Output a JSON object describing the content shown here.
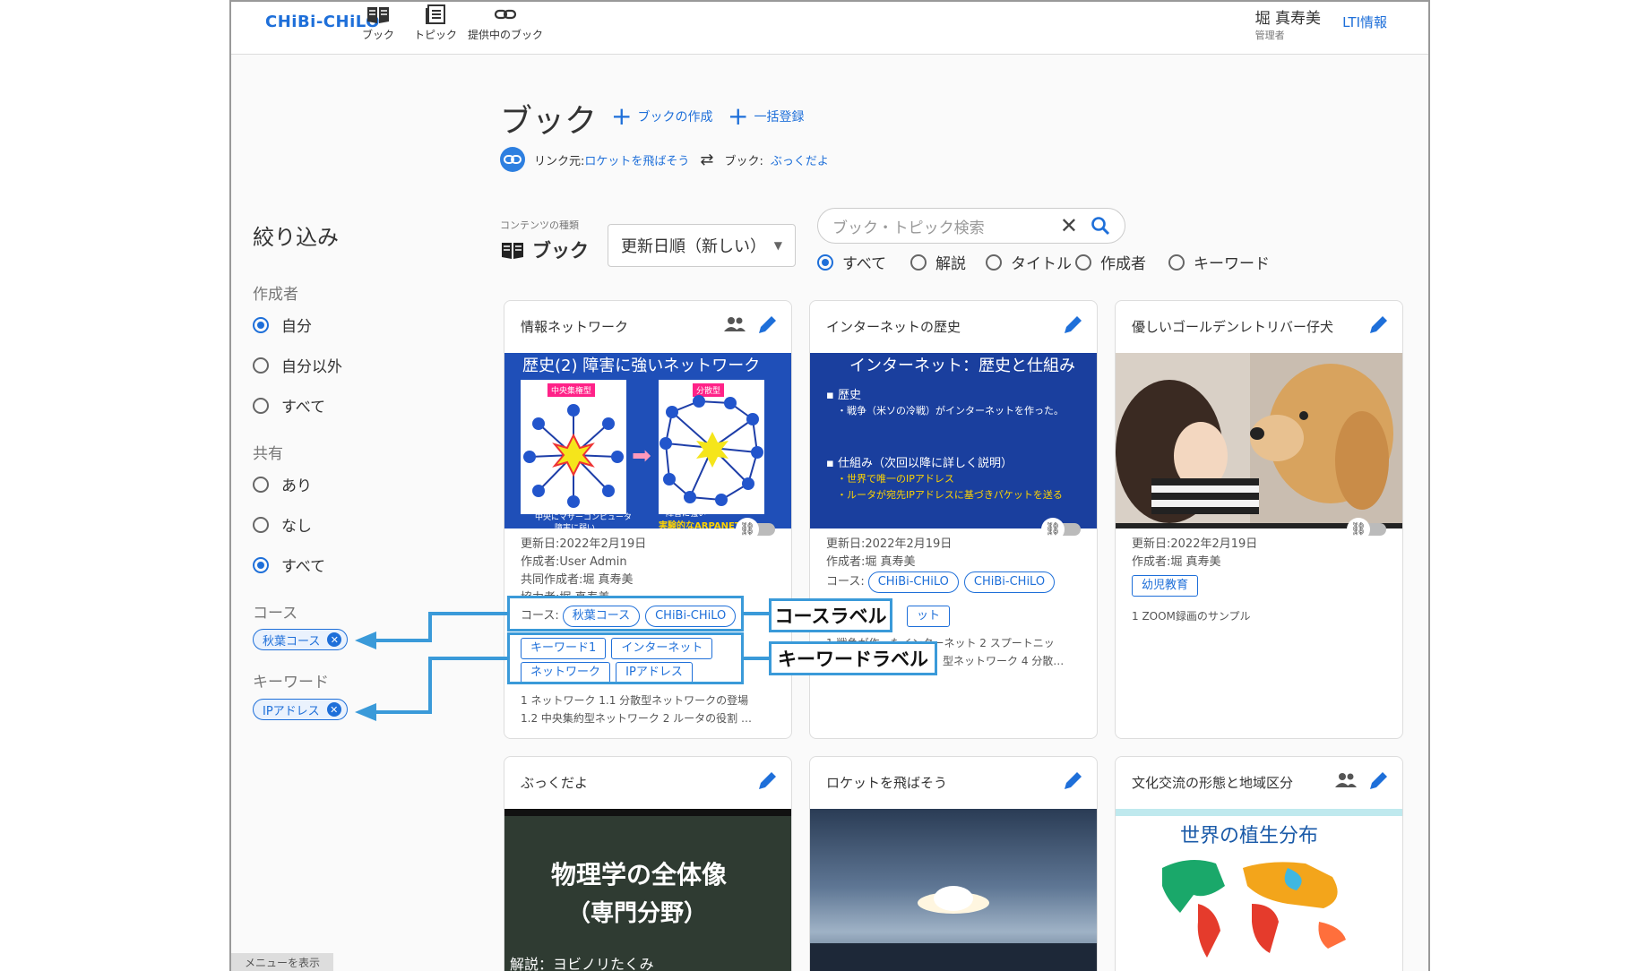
{
  "header": {
    "logo": "CHiBi-CHiLO",
    "nav": [
      {
        "label": "ブック",
        "icon": "book-icon"
      },
      {
        "label": "トピック",
        "icon": "topic-icon"
      },
      {
        "label": "提供中のブック",
        "icon": "link-icon"
      }
    ],
    "user_name": "堀 真寿美",
    "user_role": "管理者",
    "lti_label": "LTI情報"
  },
  "page": {
    "title": "ブック",
    "create_label": "ブックの作成",
    "bulk_label": "一括登録",
    "link_source_label": "リンク元:",
    "link_source_value": "ロケットを飛ばそう",
    "book_label": "ブック:",
    "book_value": "ぶっくだよ"
  },
  "filter": {
    "title": "絞り込み",
    "author_head": "作成者",
    "author_options": [
      "自分",
      "自分以外",
      "すべて"
    ],
    "author_selected": 0,
    "share_head": "共有",
    "share_options": [
      "あり",
      "なし",
      "すべて"
    ],
    "share_selected": 2,
    "course_head": "コース",
    "course_chip": "秋葉コース",
    "keyword_head": "キーワード",
    "keyword_chip": "IPアドレス"
  },
  "toolbar": {
    "content_type_label": "コンテンツの種類",
    "content_type": "ブック",
    "sort_value": "更新日順（新しい）",
    "search_placeholder": "ブック・トピック検索",
    "search_scopes": [
      "すべて",
      "解説",
      "タイトル",
      "作成者",
      "キーワード"
    ],
    "search_scope_selected": 0
  },
  "cards": [
    {
      "title": "情報ネットワーク",
      "thumb_title": "歴史(2) 障害に強いネットワーク",
      "thumb_tag1": "中央集権型",
      "thumb_tag2": "分散型",
      "thumb_cap1": "中央にマザーコンピュータ",
      "thumb_cap1b": "障害に弱い",
      "thumb_cap2": "障害に強い",
      "thumb_cap2b": "実験的なARPANET",
      "updated": "更新日:2022年2月19日",
      "author": "作成者:User Admin",
      "coauthor": "共同作成者:堀 真寿美",
      "collab": "協力者:堀 真寿美",
      "course_prefix": "コース:",
      "courses": [
        "秋葉コース",
        "CHiBi-CHiLO"
      ],
      "keywords": [
        "キーワード1",
        "インターネット",
        "ネットワーク",
        "IPアドレス"
      ],
      "toc1": "1 ネットワーク 1.1 分散型ネットワークの登場",
      "toc2": "1.2 中央集約型ネットワーク 2 ルータの役割 …"
    },
    {
      "title": "インターネットの歴史",
      "thumb_title": "インターネット：歴史と仕組み",
      "thumb_l1": "▪ 歴史",
      "thumb_l2": "・戦争（米ソの冷戦）がインターネットを作った。",
      "thumb_l3": "▪ 仕組み（次回以降に詳しく説明）",
      "thumb_l4": "・世界で唯一のIPアドレス",
      "thumb_l5": "・ルータが宛先IPアドレスに基づきパケットを送る",
      "updated": "更新日:2022年2月19日",
      "author": "作成者:堀 真寿美",
      "course_prefix": "コース:",
      "courses": [
        "CHiBi-CHiLO",
        "CHiBi-CHiLO"
      ],
      "keyword_partial": "ット",
      "toc1": "1 戦争が作ったインターネット 2 スプートニッ",
      "toc2": "型ネットワーク 4 分散…"
    },
    {
      "title": "優しいゴールデンレトリバー仔犬",
      "updated": "更新日:2022年2月19日",
      "author": "作成者:堀 真寿美",
      "tag": "幼児教育",
      "desc": "1 ZOOM録画のサンプル"
    },
    {
      "title": "ぶっくだよ",
      "thumb_title": "物理学の全体像",
      "thumb_sub": "（専門分野）",
      "thumb_cap": "解説：ヨビノリたくみ"
    },
    {
      "title": "ロケットを飛ばそう"
    },
    {
      "title": "文化交流の形態と地域区分",
      "thumb_title": "世界の植生分布"
    }
  ],
  "callouts": {
    "course_label": "コースラベル",
    "keyword_label": "キーワードラベル"
  },
  "footer": {
    "menu_show": "メニューを表示"
  },
  "colors": {
    "accent": "#1e6fd9",
    "callout": "#3a9ad9"
  }
}
